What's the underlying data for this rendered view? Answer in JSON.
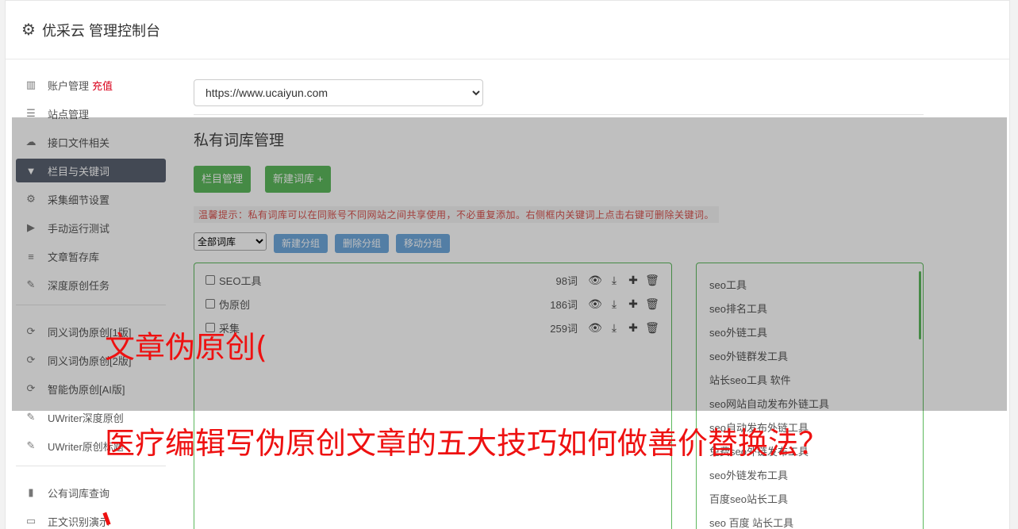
{
  "header": {
    "title": "优采云 管理控制台"
  },
  "sidebar": {
    "items": [
      {
        "label": "账户管理",
        "extra": "充值",
        "icon": "bar-chart-icon"
      },
      {
        "label": "站点管理",
        "icon": "server-icon"
      },
      {
        "label": "接口文件相关",
        "icon": "cloud-upload-icon"
      },
      {
        "label": "栏目与关键词",
        "icon": "filter-icon",
        "active": true
      },
      {
        "label": "采集细节设置",
        "icon": "cogs-icon"
      },
      {
        "label": "手动运行测试",
        "icon": "play-circle-icon"
      },
      {
        "label": "文章暂存库",
        "icon": "database-icon"
      },
      {
        "label": "深度原创任务",
        "icon": "edit-icon"
      }
    ],
    "items2": [
      {
        "label": "同义词伪原创[1版]",
        "icon": "refresh-icon"
      },
      {
        "label": "同义词伪原创[2版]",
        "icon": "refresh-icon"
      },
      {
        "label": "智能伪原创[AI版]",
        "icon": "refresh-icon"
      },
      {
        "label": "UWriter深度原创",
        "icon": "edit-icon"
      },
      {
        "label": "UWriter原创标题",
        "icon": "edit-icon"
      }
    ],
    "items3": [
      {
        "label": "公有词库查询",
        "icon": "book-icon"
      },
      {
        "label": "正文识别演示",
        "icon": "monitor-icon"
      }
    ]
  },
  "main": {
    "site_value": "https://www.ucaiyun.com",
    "page_title": "私有词库管理",
    "btn_column": "栏目管理",
    "btn_new_lib": "新建词库 +",
    "tip": "温馨提示：私有词库可以在同账号不同网站之间共享使用，不必重复添加。右侧框内关键词上点击右键可删除关键词。",
    "group_select": "全部词库",
    "btn_new_group": "新建分组",
    "btn_del_group": "删除分组",
    "btn_move_group": "移动分组",
    "libraries": [
      {
        "name": "SEO工具",
        "count": "98词"
      },
      {
        "name": "伪原创",
        "count": "186词"
      },
      {
        "name": "采集",
        "count": "259词"
      }
    ],
    "keywords": [
      "seo工具",
      "seo排名工具",
      "seo外链工具",
      "seo外链群发工具",
      "站长seo工具 软件",
      "seo网站自动发布外链工具",
      "seo自动发布外链工具",
      "免费seo外链发布工具",
      "seo外链发布工具",
      "百度seo站长工具",
      "seo 百度 站长工具"
    ]
  },
  "overlay": {
    "title": "文章伪原创(",
    "headline": "医疗编辑写伪原创文章的五大技巧如何做善价替换法？"
  },
  "colors": {
    "accent_green": "#5cb85c",
    "accent_blue": "#6fa8dc",
    "overlay_red": "#ee1111",
    "active_nav": "#5a6270"
  }
}
